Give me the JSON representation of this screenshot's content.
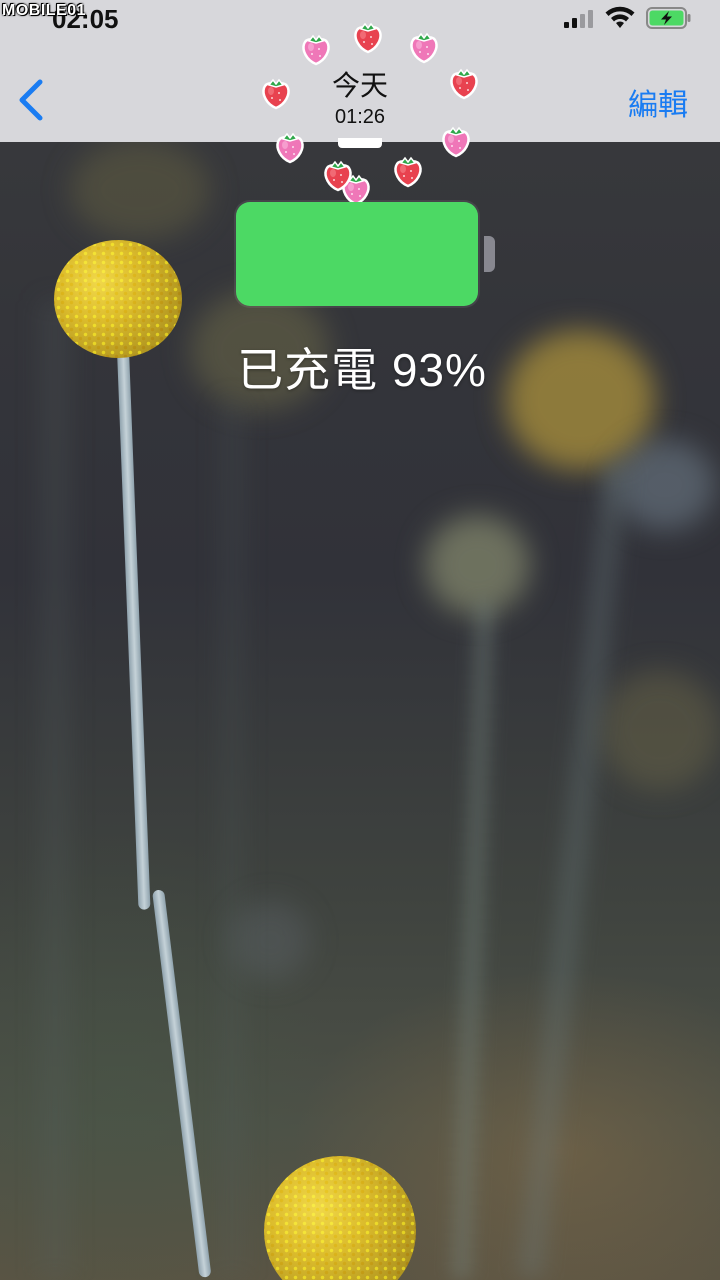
{
  "watermark": "MOBILE01",
  "status_bar": {
    "time": "02:05",
    "signal_bars": 4,
    "signal_bars_active": 2,
    "wifi": "wifi-icon",
    "battery_charging": true,
    "battery_color": "#4cd964"
  },
  "nav": {
    "back_icon": "chevron-left-icon",
    "title": "今天",
    "subtitle": "01:26",
    "edit_label": "編輯",
    "accent": "#1a7cf2"
  },
  "charging": {
    "text": "已充電 93%",
    "level": 0.93,
    "color": "#4cd964"
  },
  "decorations": {
    "icon": "strawberry-icon"
  }
}
